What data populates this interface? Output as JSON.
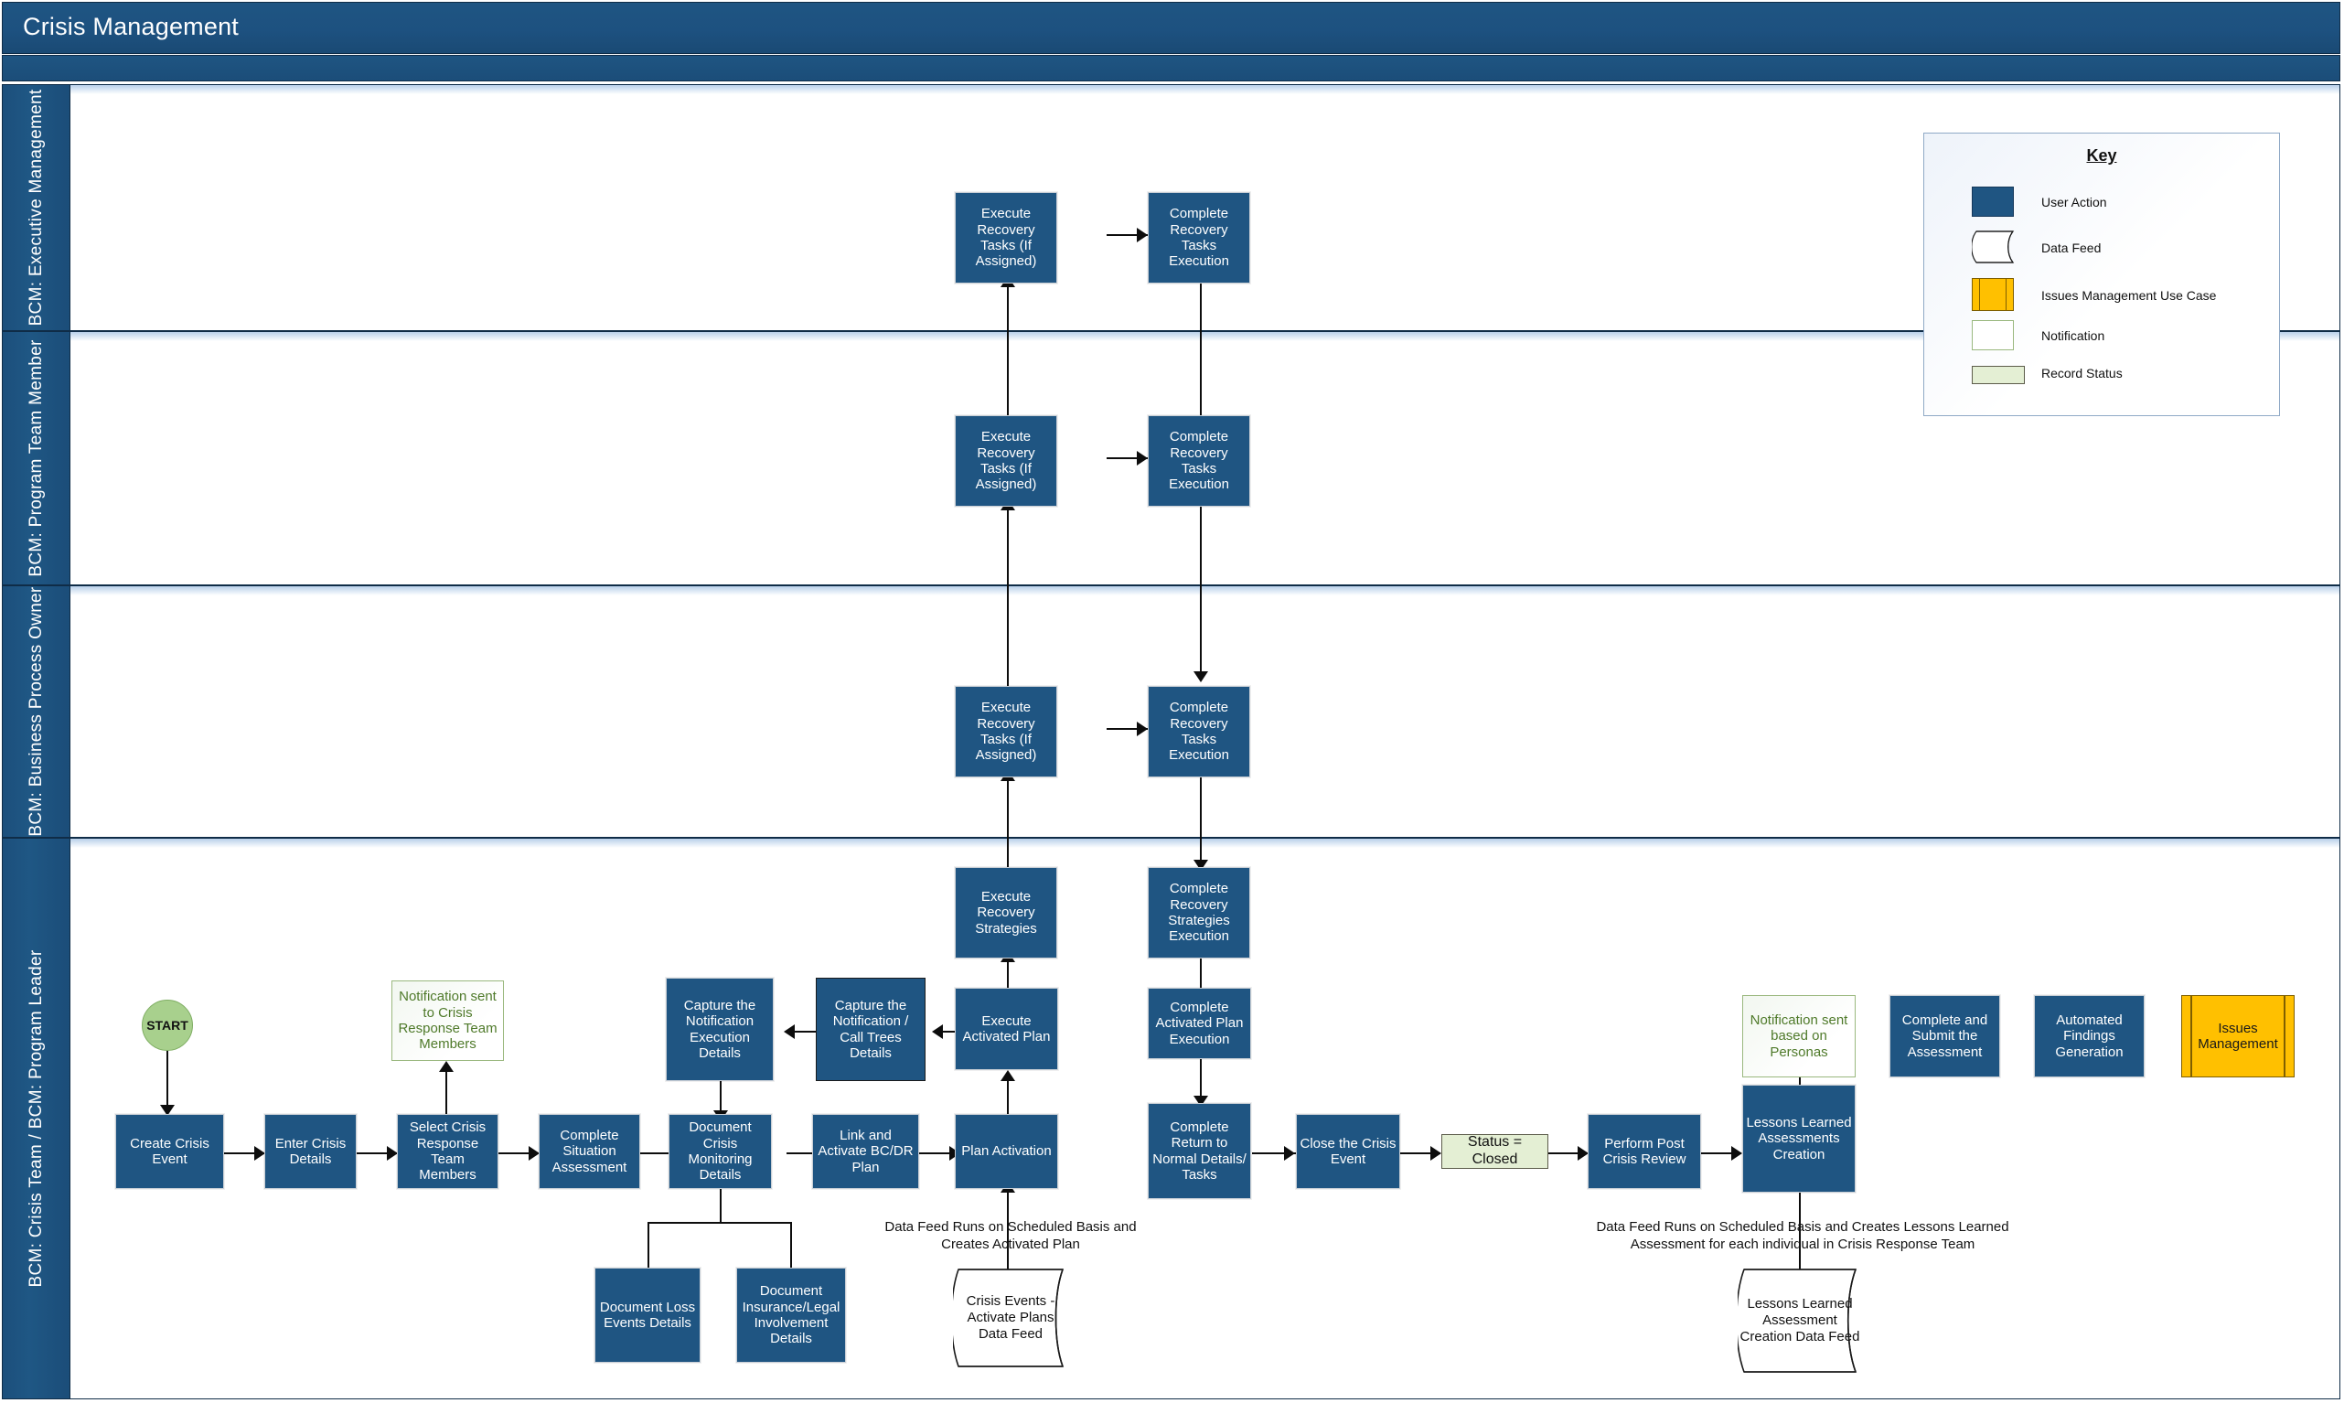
{
  "header": {
    "title": "Crisis Management"
  },
  "lanes": [
    {
      "id": "exec",
      "label": "BCM: Executive Management"
    },
    {
      "id": "program",
      "label": "BCM: Program Team Member"
    },
    {
      "id": "bpo",
      "label": "BCM: Business Process Owner"
    },
    {
      "id": "crisis",
      "label": "BCM: Crisis Team / BCM: Program Leader"
    }
  ],
  "key": {
    "title": "Key",
    "items": [
      {
        "label": "User Action",
        "shape": "rect-filled",
        "color": "#1f5582"
      },
      {
        "label": "Data Feed",
        "shape": "cylinder",
        "color": "#ffffff"
      },
      {
        "label": "Issues Management Use Case",
        "shape": "rect-bars",
        "color": "#ffc000"
      },
      {
        "label": "Notification",
        "shape": "rect-outline",
        "color": "#9ab87e"
      },
      {
        "label": "Record Status",
        "shape": "rect-status",
        "color": "#e4efd4"
      }
    ]
  },
  "nodes": {
    "start": "START",
    "exec_execute_recovery_tasks": "Execute Recovery Tasks (If Assigned)",
    "exec_complete_recovery_tasks": "Complete Recovery Tasks Execution",
    "prog_execute_recovery_tasks": "Execute Recovery Tasks (If Assigned)",
    "prog_complete_recovery_tasks": "Complete Recovery Tasks Execution",
    "bpo_execute_recovery_tasks": "Execute Recovery Tasks (If Assigned)",
    "bpo_complete_recovery_tasks": "Complete Recovery Tasks Execution",
    "execute_recovery_strategies": "Execute Recovery Strategies",
    "complete_recovery_strategies_execution": "Complete Recovery Strategies Execution",
    "create_crisis_event": "Create Crisis Event",
    "enter_crisis_details": "Enter Crisis Details",
    "select_crisis_response_team_members": "Select Crisis Response Team Members",
    "notification_crisis_response_team": "Notification sent to Crisis Response Team Members",
    "complete_situation_assessment": "Complete Situation Assessment",
    "document_crisis_monitoring_details": "Document Crisis Monitoring Details",
    "capture_notification_execution_details": "Capture the Notification Execution Details",
    "capture_notification_call_trees_details": "Capture the Notification / Call Trees Details",
    "execute_activated_plan": "Execute Activated Plan",
    "link_activate_bcdr_plan": "Link and Activate BC/DR Plan",
    "plan_activation": "Plan Activation",
    "document_loss_events_details": "Document Loss Events Details",
    "document_insurance_legal_details": "Document Insurance/Legal Involvement Details",
    "complete_activated_plan_execution": "Complete Activated Plan Execution",
    "complete_return_to_normal": "Complete Return to Normal Details/ Tasks",
    "close_the_crisis_event": "Close the Crisis Event",
    "status_closed": "Status = Closed",
    "perform_post_crisis_review": "Perform Post Crisis Review",
    "lessons_learned_assessments_creation": "Lessons Learned Assessments Creation",
    "notification_based_on_personas": "Notification sent based on Personas",
    "complete_and_submit_assessment": "Complete and Submit the Assessment",
    "automated_findings_generation": "Automated Findings Generation",
    "issues_management": "Issues Management"
  },
  "datafeeds": {
    "crisis_events_activate_plans": "Crisis Events - Activate Plans Data Feed",
    "lessons_learned_creation": "Lessons Learned Assessment Creation Data Feed"
  },
  "captions": {
    "activate_plans_note": "Data Feed Runs on Scheduled Basis and Creates Activated Plan",
    "lessons_learned_note": "Data Feed Runs on Scheduled Basis and Creates Lessons Learned Assessment for each individual in Crisis Response Team"
  },
  "colors": {
    "user_action": "#1f5582",
    "use_case": "#ffc000",
    "notification_border": "#9ab87e",
    "notification_text": "#4f7a2a",
    "record_status": "#e4efd4",
    "start": "#a8d08d",
    "lane_header": "#1f5582",
    "connector": "#0d0d0d"
  }
}
